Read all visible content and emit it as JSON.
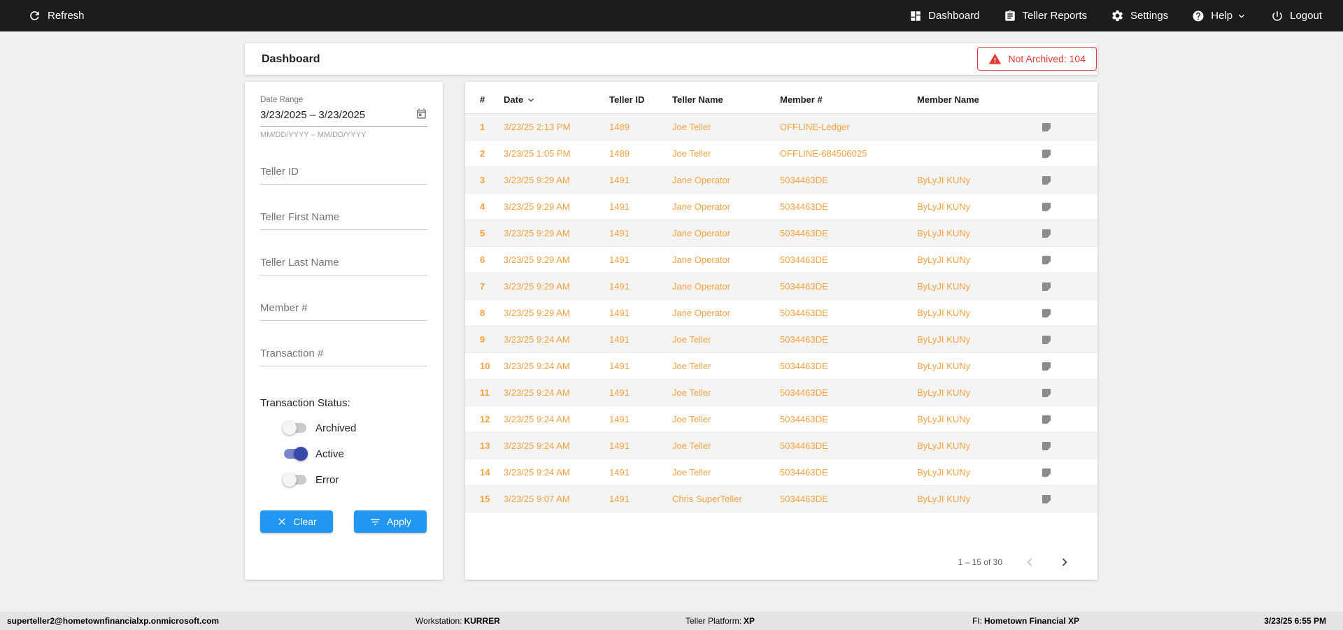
{
  "colors": {
    "accent_orange": "#F9A03F",
    "button_blue": "#2196F3",
    "toggle_blue": "#3949AB",
    "error_red": "#E53935",
    "topbar_bg": "#1C1C1C"
  },
  "topbar": {
    "refresh_label": "Refresh",
    "nav": [
      {
        "label": "Dashboard",
        "icon": "dashboard-icon"
      },
      {
        "label": "Teller Reports",
        "icon": "reports-icon"
      },
      {
        "label": "Settings",
        "icon": "settings-icon"
      },
      {
        "label": "Help",
        "icon": "help-icon",
        "has_dropdown": true
      },
      {
        "label": "Logout",
        "icon": "logout-icon"
      }
    ]
  },
  "header": {
    "title": "Dashboard",
    "not_archived_label": "Not Archived: 104"
  },
  "filters": {
    "date_range": {
      "label": "Date Range",
      "value": "3/23/2025 – 3/23/2025",
      "hint": "MM/DD/YYYY – MM/DD/YYYY",
      "icon": "calendar-icon"
    },
    "teller_id_placeholder": "Teller ID",
    "teller_first_name_placeholder": "Teller First Name",
    "teller_last_name_placeholder": "Teller Last Name",
    "member_num_placeholder": "Member #",
    "transaction_num_placeholder": "Transaction #",
    "status_label": "Transaction Status:",
    "toggles": [
      {
        "label": "Archived",
        "on": false
      },
      {
        "label": "Active",
        "on": true
      },
      {
        "label": "Error",
        "on": false
      }
    ],
    "clear_label": "Clear",
    "apply_label": "Apply"
  },
  "table": {
    "columns": [
      "#",
      "Date",
      "Teller ID",
      "Teller Name",
      "Member #",
      "Member Name"
    ],
    "sort": {
      "column": "Date",
      "direction": "desc"
    },
    "rows": [
      {
        "num": "1",
        "date": "3/23/25 2:13 PM",
        "teller_id": "1489",
        "teller_name": "Joe Teller",
        "member_num": "OFFLINE-Ledger",
        "member_name": ""
      },
      {
        "num": "2",
        "date": "3/23/25 1:05 PM",
        "teller_id": "1489",
        "teller_name": "Joe Teller",
        "member_num": "OFFLINE-684506025",
        "member_name": ""
      },
      {
        "num": "3",
        "date": "3/23/25 9:29 AM",
        "teller_id": "1491",
        "teller_name": "Jane Operator",
        "member_num": "5034463DE",
        "member_name": "ByLyJI KUNy"
      },
      {
        "num": "4",
        "date": "3/23/25 9:29 AM",
        "teller_id": "1491",
        "teller_name": "Jane Operator",
        "member_num": "5034463DE",
        "member_name": "ByLyJI KUNy"
      },
      {
        "num": "5",
        "date": "3/23/25 9:29 AM",
        "teller_id": "1491",
        "teller_name": "Jane Operator",
        "member_num": "5034463DE",
        "member_name": "ByLyJI KUNy"
      },
      {
        "num": "6",
        "date": "3/23/25 9:29 AM",
        "teller_id": "1491",
        "teller_name": "Jane Operator",
        "member_num": "5034463DE",
        "member_name": "ByLyJI KUNy"
      },
      {
        "num": "7",
        "date": "3/23/25 9:29 AM",
        "teller_id": "1491",
        "teller_name": "Jane Operator",
        "member_num": "5034463DE",
        "member_name": "ByLyJI KUNy"
      },
      {
        "num": "8",
        "date": "3/23/25 9:29 AM",
        "teller_id": "1491",
        "teller_name": "Jane Operator",
        "member_num": "5034463DE",
        "member_name": "ByLyJI KUNy"
      },
      {
        "num": "9",
        "date": "3/23/25 9:24 AM",
        "teller_id": "1491",
        "teller_name": "Joe Teller",
        "member_num": "5034463DE",
        "member_name": "ByLyJI KUNy"
      },
      {
        "num": "10",
        "date": "3/23/25 9:24 AM",
        "teller_id": "1491",
        "teller_name": "Joe Teller",
        "member_num": "5034463DE",
        "member_name": "ByLyJI KUNy"
      },
      {
        "num": "11",
        "date": "3/23/25 9:24 AM",
        "teller_id": "1491",
        "teller_name": "Joe Teller",
        "member_num": "5034463DE",
        "member_name": "ByLyJI KUNy"
      },
      {
        "num": "12",
        "date": "3/23/25 9:24 AM",
        "teller_id": "1491",
        "teller_name": "Joe Teller",
        "member_num": "5034463DE",
        "member_name": "ByLyJI KUNy"
      },
      {
        "num": "13",
        "date": "3/23/25 9:24 AM",
        "teller_id": "1491",
        "teller_name": "Joe Teller",
        "member_num": "5034463DE",
        "member_name": "ByLyJI KUNy"
      },
      {
        "num": "14",
        "date": "3/23/25 9:24 AM",
        "teller_id": "1491",
        "teller_name": "Joe Teller",
        "member_num": "5034463DE",
        "member_name": "ByLyJI KUNy"
      },
      {
        "num": "15",
        "date": "3/23/25 9:07 AM",
        "teller_id": "1491",
        "teller_name": "Chris SuperTeller",
        "member_num": "5034463DE",
        "member_name": "ByLyJI KUNy"
      }
    ],
    "row_note_icon": "note-icon",
    "pagination": {
      "range_label": "1 – 15 of 30"
    }
  },
  "statusbar": {
    "user_email": "superteller2@hometownfinancialxp.onmicrosoft.com",
    "workstation_label": "Workstation:",
    "workstation_value": "KURRER",
    "platform_label": "Teller Platform:",
    "platform_value": "XP",
    "fi_label": "FI:",
    "fi_value": "Hometown Financial XP",
    "datetime": "3/23/25 6:55 PM"
  }
}
